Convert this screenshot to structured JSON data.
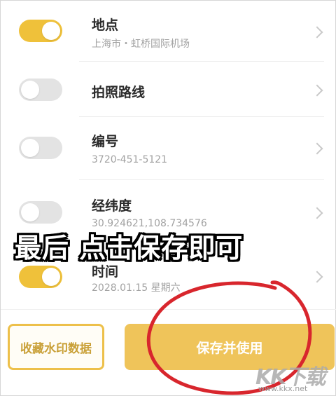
{
  "settings": [
    {
      "title": "地点",
      "subtitle": "上海市・虹桥国际机场",
      "enabled": true
    },
    {
      "title": "拍照路线",
      "subtitle": "",
      "enabled": false
    },
    {
      "title": "编号",
      "subtitle": "3720-451-5121",
      "enabled": false
    },
    {
      "title": "经纬度",
      "subtitle": "30.924621,108.734576",
      "enabled": false
    },
    {
      "title": "时间",
      "subtitle": "2028.01.15 星期六",
      "enabled": true
    }
  ],
  "footer": {
    "collect_label": "收藏水印数据",
    "save_label": "保存并使用"
  },
  "overlay": {
    "caption": "最后 点击保存即可",
    "annotation_color": "#d8262d"
  },
  "watermark": {
    "logo": "KK下载",
    "url": "www.kkx.net"
  },
  "colors": {
    "accent": "#efc13a",
    "toggle_off": "#e3e3e3"
  }
}
